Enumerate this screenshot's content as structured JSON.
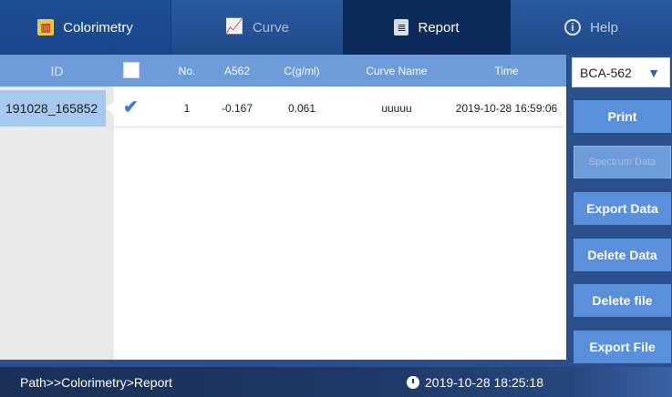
{
  "tabs": [
    {
      "label": "Colorimetry",
      "icon": "colorimetry-icon"
    },
    {
      "label": "Curve",
      "icon": "curve-icon"
    },
    {
      "label": "Report",
      "icon": "report-icon"
    },
    {
      "label": "Help",
      "icon": "help-icon"
    }
  ],
  "id_column": {
    "header": "ID",
    "items": [
      "191028_165852"
    ]
  },
  "table": {
    "headers": {
      "no": "No.",
      "a562": "A562",
      "conc": "C(g/ml)",
      "curve_name": "Curve Name",
      "time": "Time"
    },
    "rows": [
      {
        "checked": true,
        "no": "1",
        "a562": "-0.167",
        "conc": "0.061",
        "curve_name": "uuuuu",
        "time": "2019-10-28 16:59:06"
      }
    ]
  },
  "side_panel": {
    "method_select": "BCA-562",
    "buttons": {
      "print": "Print",
      "spectrum_data": "Spectrum Data",
      "export_data": "Export Data",
      "delete_data": "Delete Data",
      "delete_file": "Delete file",
      "export_file": "Export File"
    }
  },
  "status_bar": {
    "path": "Path>>Colorimetry>Report",
    "datetime": "2019-10-28 18:25:18"
  },
  "colors": {
    "accent": "#5a8fdb",
    "header": "#6e9bd9",
    "active_tab": "#0c2a5a",
    "background": "#2a4f8c"
  }
}
